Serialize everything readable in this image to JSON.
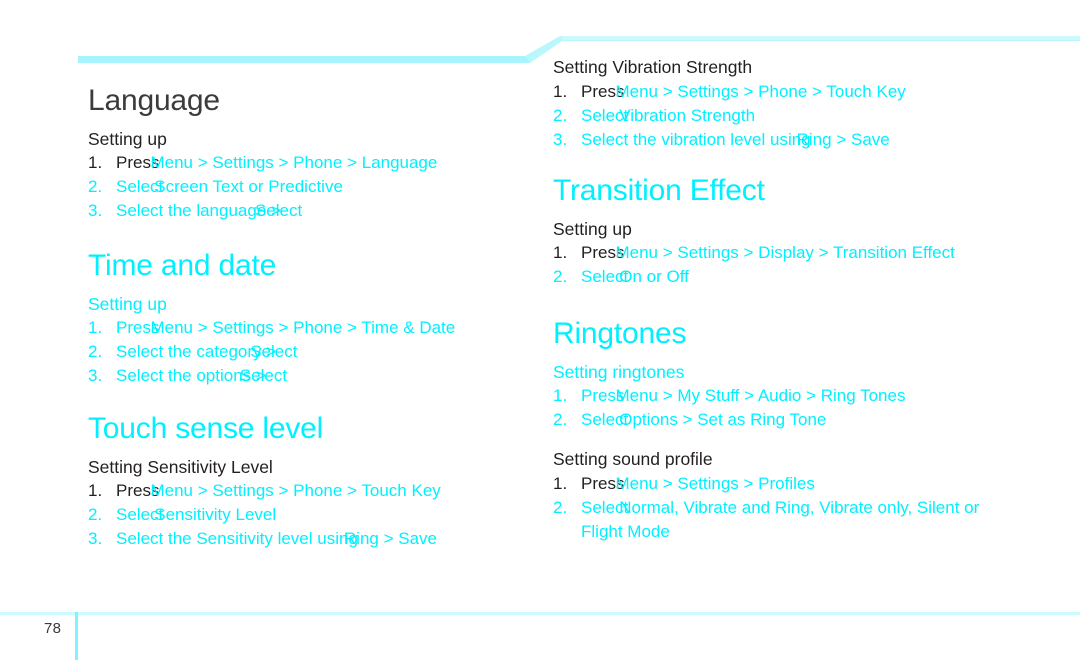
{
  "document": {
    "page_number": "78",
    "accent_color": "#00f0ff",
    "banner_color": "#b9f7fd",
    "text_color": "#231f20"
  },
  "left_column": {
    "sections": [
      {
        "title": "Language",
        "title_color": "dark",
        "sub_title": "Setting up",
        "sub_color": "dark",
        "steps": [
          {
            "num": "1.",
            "lead": "Press",
            "lead_color": "dark",
            "path": "Menu > Settings > Phone > Language"
          },
          {
            "num": "2.",
            "lead": "Select",
            "lead_color": "cyan",
            "path": "Screen Text or Predictive"
          },
          {
            "num": "3.",
            "lead": "Select the language >",
            "lead_color": "cyan",
            "path": "Select"
          }
        ]
      },
      {
        "title": "Time and date",
        "title_color": "cyan",
        "sub_title": "Setting up",
        "sub_color": "cyan",
        "steps": [
          {
            "num": "1.",
            "lead": "Press",
            "lead_color": "cyan",
            "path": "Menu > Settings > Phone > Time & Date"
          },
          {
            "num": "2.",
            "lead": "Select the category >",
            "lead_color": "cyan",
            "path": "Select"
          },
          {
            "num": "3.",
            "lead": "Select the options >",
            "lead_color": "cyan",
            "path": "Select"
          }
        ]
      },
      {
        "title": "Touch sense level",
        "title_color": "cyan",
        "sub_title": "Setting Sensitivity Level",
        "sub_color": "dark",
        "steps": [
          {
            "num": "1.",
            "lead": "Press",
            "lead_color": "dark",
            "path": "Menu > Settings > Phone > Touch Key"
          },
          {
            "num": "2.",
            "lead": "Select",
            "lead_color": "cyan",
            "path": "Sensitivity Level"
          },
          {
            "num": "3.",
            "lead": "Select the Sensitivity level using",
            "lead_color": "cyan",
            "path": "Ring > Save"
          }
        ]
      }
    ]
  },
  "right_column": {
    "sections": [
      {
        "title": "",
        "title_color": "dark",
        "sub_title": "Setting Vibration Strength",
        "sub_color": "dark",
        "steps": [
          {
            "num": "1.",
            "lead": "Press",
            "lead_color": "dark",
            "path": "Menu > Settings > Phone > Touch Key"
          },
          {
            "num": "2.",
            "lead": "Select",
            "lead_color": "cyan",
            "path": "Vibration Strength"
          },
          {
            "num": "3.",
            "lead": "Select the vibration level using",
            "lead_color": "cyan",
            "path": "Ring > Save"
          }
        ]
      },
      {
        "title": "Transition Effect",
        "title_color": "cyan",
        "sub_title": "Setting up",
        "sub_color": "dark",
        "steps": [
          {
            "num": "1.",
            "lead": "Press",
            "lead_color": "dark",
            "path": "Menu > Settings > Display > Transition Effect"
          },
          {
            "num": "2.",
            "lead": "Select",
            "lead_color": "cyan",
            "path": "On or Off"
          }
        ]
      },
      {
        "title": "Ringtones",
        "title_color": "cyan",
        "sub_title": "Setting ringtones",
        "sub_color": "cyan",
        "steps": [
          {
            "num": "1.",
            "lead": "Press",
            "lead_color": "cyan",
            "path": "Menu > My Stuff > Audio > Ring Tones"
          },
          {
            "num": "2.",
            "lead": "Select",
            "lead_color": "cyan",
            "path": "Options > Set as Ring Tone"
          }
        ]
      },
      {
        "title": "",
        "title_color": "dark",
        "sub_title": "Setting sound profile",
        "sub_color": "dark",
        "steps": [
          {
            "num": "1.",
            "lead": "Press",
            "lead_color": "dark",
            "path": "Menu > Settings > Profiles"
          },
          {
            "num": "2.",
            "lead": "Select",
            "lead_color": "cyan",
            "path": "Normal, Vibrate and Ring, Vibrate only, Silent or"
          }
        ],
        "continuation": "Flight Mode"
      }
    ]
  }
}
